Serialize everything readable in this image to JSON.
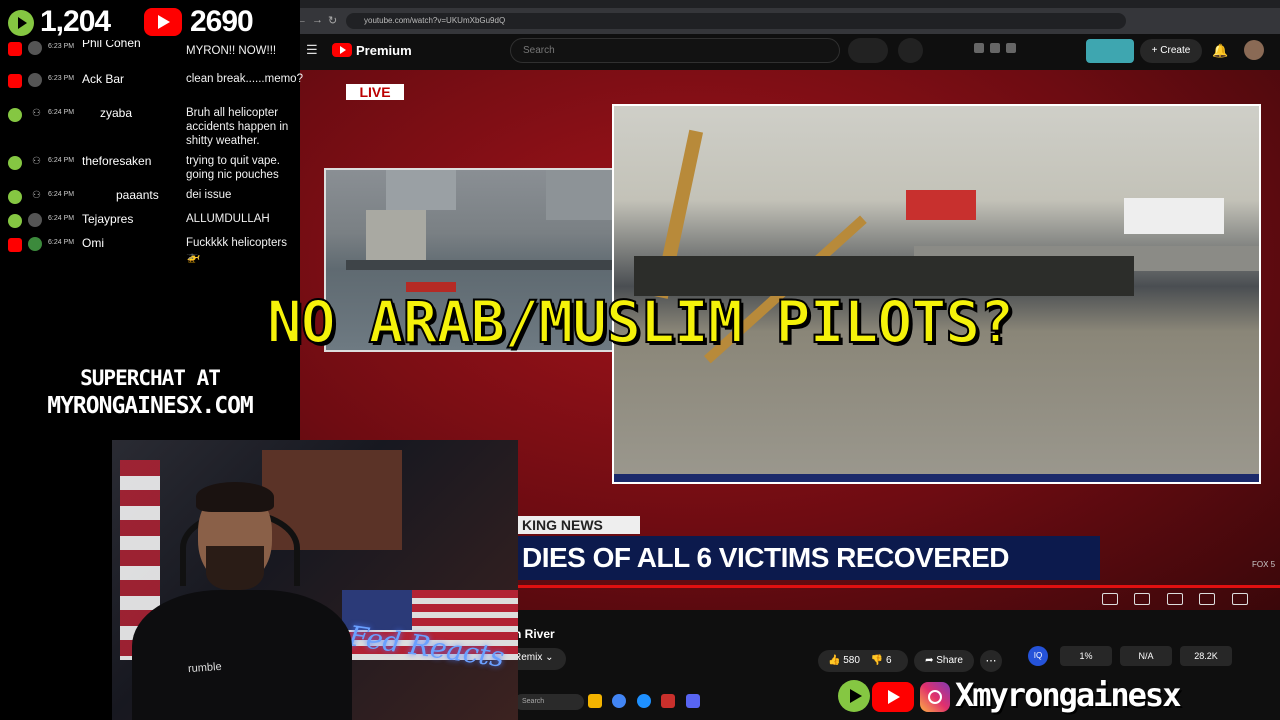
{
  "counters": {
    "rumble_count": "1,204",
    "youtube_count": "2690"
  },
  "browser": {
    "url": "youtube.com/watch?v=UKUmXbGu9dQ",
    "yt_brand": "Premium",
    "search_placeholder": "Search",
    "create_label": "Create"
  },
  "video": {
    "live_label": "LIVE",
    "breaking_tag": "KING NEWS",
    "headline": "DIES OF ALL 6 VICTIMS RECOVERED",
    "network": "FOX 5",
    "progress": 1.0
  },
  "below_video": {
    "title_fragment": "n River",
    "remix_label": "Remix",
    "likes": "580",
    "dislikes": "6",
    "share_label": "Share",
    "stats": [
      "1%",
      "N/A",
      "28.2K"
    ],
    "taskbar_search": "Search"
  },
  "chat": [
    {
      "platform": "youtube",
      "time": "6:23 PM",
      "user": "Phil Cohen",
      "msg": "SHUT THIS OFF MYRON!! NOW!!!"
    },
    {
      "platform": "youtube",
      "time": "6:23 PM",
      "user": "Ack Bar",
      "msg": "clean break......memo?"
    },
    {
      "platform": "rumble",
      "time": "6:24 PM",
      "user": "zyaba",
      "msg": "Bruh all helicopter accidents happen in shitty weather."
    },
    {
      "platform": "rumble",
      "time": "6:24 PM",
      "user": "theforesaken",
      "msg": "trying to quit vape. going nic pouches"
    },
    {
      "platform": "rumble",
      "time": "6:24 PM",
      "user": "paaants",
      "msg": "dei issue"
    },
    {
      "platform": "rumble",
      "time": "6:24 PM",
      "user": "Tejaypres",
      "msg": "ALLUMDULLAH"
    },
    {
      "platform": "youtube",
      "time": "6:24 PM",
      "user": "Omi",
      "msg": "Fuckkkk helicopters 🚁"
    }
  ],
  "superchat": {
    "line1": "SUPERCHAT AT",
    "line2": "MYRONGAINESX.COM"
  },
  "overlay_headline": "NO ARAB/MUSLIM PILOTS?",
  "webcam": {
    "neon_sign": "Fed Reacts",
    "shirt_text": "rumble"
  },
  "socials": {
    "handle": "myrongainesx"
  },
  "colors": {
    "accent_yellow": "#f5f20a",
    "rumble_green": "#85c742",
    "youtube_red": "#ff0000",
    "news_red": "#a3131b"
  }
}
